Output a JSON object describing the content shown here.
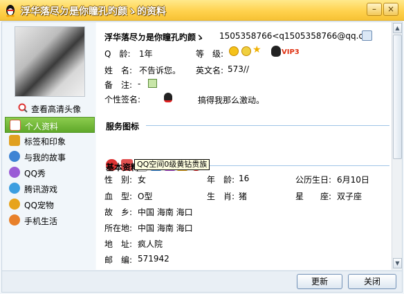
{
  "window": {
    "title": "浮华落尽ㄉ是你瞳孔旳颜ゝ的资料",
    "minimize": "–",
    "close": "×"
  },
  "sidebar": {
    "view_hd_avatar": "查看高清头像",
    "items": [
      {
        "label": "个人资料",
        "active": true,
        "color": "#e05a3c"
      },
      {
        "label": "标签和印象",
        "active": false,
        "color": "#e0a020"
      },
      {
        "label": "与我的故事",
        "active": false,
        "color": "#3d83d4"
      },
      {
        "label": "QQ秀",
        "active": false,
        "color": "#9a5cd6"
      },
      {
        "label": "腾讯游戏",
        "active": false,
        "color": "#3c9ee0"
      },
      {
        "label": "QQ宠物",
        "active": false,
        "color": "#e7a41c"
      },
      {
        "label": "手机生活",
        "active": false,
        "color": "#e8802a"
      }
    ]
  },
  "profile": {
    "nickname": "浮华落尽ㄉ是你瞳孔旳颜ゝ",
    "qq_email": "1505358766<q1505358766@qq.cc",
    "qage_label": "Q　龄:",
    "qage_value": "1年",
    "level_label": "等　级:",
    "vip_text": "VIP3",
    "name_label": "姓　名:",
    "name_value": "不告诉您。",
    "english_label": "英文名:",
    "english_value": "573//",
    "note_label": "备　注:",
    "note_value": "-",
    "signature_label": "个性签名:",
    "signature_value": "搞得我那么激动。"
  },
  "services": {
    "title": "服务图标",
    "tooltip": "QQ空间0级黄钻贵族",
    "icons": [
      {
        "name": "qq-penguin-icon",
        "color": "#d33"
      },
      {
        "name": "red-chat-icon",
        "color": "#e05050"
      },
      {
        "name": "blank-service-icon",
        "color": "#ffffff"
      },
      {
        "name": "blue-diamond-icon",
        "color": "#3a8fe0"
      },
      {
        "name": "purple-diamond-icon",
        "color": "#b04ad6"
      },
      {
        "name": "yellow-vip-icon",
        "color": "#e8a617"
      },
      {
        "name": "red-heart-icon",
        "color": "#e02a2a"
      }
    ]
  },
  "basic": {
    "title": "基本资料",
    "gender_label": "性　别:",
    "gender_value": "女",
    "age_label": "年　龄:",
    "age_value": "16",
    "birthday_label": "公历生日:",
    "birthday_value": "6月10日",
    "blood_label": "血　型:",
    "blood_value": "O型",
    "zodiac_label": "生　肖:",
    "zodiac_value": "猪",
    "constellation_label": "星　　座:",
    "constellation_value": "双子座",
    "hometown_label": "故　乡:",
    "hometown_value": "中国 海南 海口",
    "location_label": "所在地:",
    "location_value": "中国 海南 海口",
    "address_label": "地　址:",
    "address_value": "疯人院",
    "zip_label": "邮　编:",
    "zip_value": "571942"
  },
  "buttons": {
    "refresh": "更新",
    "close": "关闭"
  }
}
